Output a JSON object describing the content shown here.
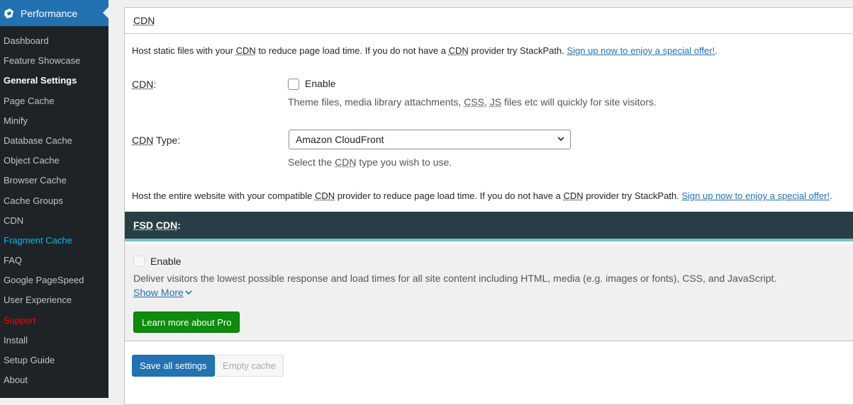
{
  "sidebar": {
    "title": "Performance",
    "items": [
      {
        "label": "Dashboard"
      },
      {
        "label": "Feature Showcase"
      },
      {
        "label": "General Settings"
      },
      {
        "label": "Page Cache"
      },
      {
        "label": "Minify"
      },
      {
        "label": "Database Cache"
      },
      {
        "label": "Object Cache"
      },
      {
        "label": "Browser Cache"
      },
      {
        "label": "Cache Groups"
      },
      {
        "label": "CDN"
      },
      {
        "label": "Fragment Cache"
      },
      {
        "label": "FAQ"
      },
      {
        "label": "Google PageSpeed"
      },
      {
        "label": "User Experience"
      },
      {
        "label": "Support"
      },
      {
        "label": "Install"
      },
      {
        "label": "Setup Guide"
      },
      {
        "label": "About"
      }
    ]
  },
  "cdn_section": {
    "header": "CDN",
    "intro_before": "Host static files with your ",
    "intro_abbr1": "CDN",
    "intro_middle": " to reduce page load time. If you do not have a ",
    "intro_abbr2": "CDN",
    "intro_after": " provider try StackPath. ",
    "intro_link": "Sign up now to enjoy a special offer!",
    "intro_end": ".",
    "cdn_label": "CDN",
    "cdn_label_suffix": ":",
    "enable_label": "Enable",
    "enable_hint_a": "Theme files, media library attachments, ",
    "enable_hint_css": "CSS",
    "enable_hint_b": ", ",
    "enable_hint_js": "JS",
    "enable_hint_c": " files etc will quickly for site visitors.",
    "type_label_abbr": "CDN",
    "type_label_rest": " Type:",
    "type_value": "Amazon CloudFront",
    "type_hint_a": "Select the ",
    "type_hint_abbr": "CDN",
    "type_hint_b": " type you wish to use.",
    "fsd_intro_a": "Host the entire website with your compatible ",
    "fsd_intro_abbr1": "CDN",
    "fsd_intro_b": " provider to reduce page load time. If you do not have a ",
    "fsd_intro_abbr2": "CDN",
    "fsd_intro_c": " provider try StackPath. ",
    "fsd_intro_link": "Sign up now to enjoy a special offer!",
    "fsd_intro_end": "."
  },
  "fsd": {
    "header_abbr1": "FSD",
    "header_abbr2": "CDN",
    "header_suffix": ":",
    "enable_label": "Enable",
    "description": "Deliver visitors the lowest possible response and load times for all site content including HTML, media (e.g. images or fonts), CSS, and JavaScript.",
    "show_more": "Show More",
    "pro_button": "Learn more about Pro"
  },
  "actions": {
    "save": "Save all settings",
    "empty": "Empty cache"
  }
}
